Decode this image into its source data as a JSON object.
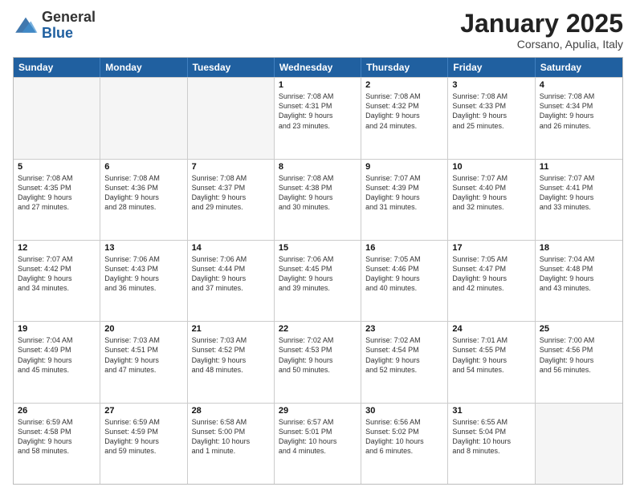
{
  "logo": {
    "general": "General",
    "blue": "Blue"
  },
  "header": {
    "title": "January 2025",
    "subtitle": "Corsano, Apulia, Italy"
  },
  "weekdays": [
    "Sunday",
    "Monday",
    "Tuesday",
    "Wednesday",
    "Thursday",
    "Friday",
    "Saturday"
  ],
  "weeks": [
    [
      {
        "day": "",
        "info": ""
      },
      {
        "day": "",
        "info": ""
      },
      {
        "day": "",
        "info": ""
      },
      {
        "day": "1",
        "info": "Sunrise: 7:08 AM\nSunset: 4:31 PM\nDaylight: 9 hours\nand 23 minutes."
      },
      {
        "day": "2",
        "info": "Sunrise: 7:08 AM\nSunset: 4:32 PM\nDaylight: 9 hours\nand 24 minutes."
      },
      {
        "day": "3",
        "info": "Sunrise: 7:08 AM\nSunset: 4:33 PM\nDaylight: 9 hours\nand 25 minutes."
      },
      {
        "day": "4",
        "info": "Sunrise: 7:08 AM\nSunset: 4:34 PM\nDaylight: 9 hours\nand 26 minutes."
      }
    ],
    [
      {
        "day": "5",
        "info": "Sunrise: 7:08 AM\nSunset: 4:35 PM\nDaylight: 9 hours\nand 27 minutes."
      },
      {
        "day": "6",
        "info": "Sunrise: 7:08 AM\nSunset: 4:36 PM\nDaylight: 9 hours\nand 28 minutes."
      },
      {
        "day": "7",
        "info": "Sunrise: 7:08 AM\nSunset: 4:37 PM\nDaylight: 9 hours\nand 29 minutes."
      },
      {
        "day": "8",
        "info": "Sunrise: 7:08 AM\nSunset: 4:38 PM\nDaylight: 9 hours\nand 30 minutes."
      },
      {
        "day": "9",
        "info": "Sunrise: 7:07 AM\nSunset: 4:39 PM\nDaylight: 9 hours\nand 31 minutes."
      },
      {
        "day": "10",
        "info": "Sunrise: 7:07 AM\nSunset: 4:40 PM\nDaylight: 9 hours\nand 32 minutes."
      },
      {
        "day": "11",
        "info": "Sunrise: 7:07 AM\nSunset: 4:41 PM\nDaylight: 9 hours\nand 33 minutes."
      }
    ],
    [
      {
        "day": "12",
        "info": "Sunrise: 7:07 AM\nSunset: 4:42 PM\nDaylight: 9 hours\nand 34 minutes."
      },
      {
        "day": "13",
        "info": "Sunrise: 7:06 AM\nSunset: 4:43 PM\nDaylight: 9 hours\nand 36 minutes."
      },
      {
        "day": "14",
        "info": "Sunrise: 7:06 AM\nSunset: 4:44 PM\nDaylight: 9 hours\nand 37 minutes."
      },
      {
        "day": "15",
        "info": "Sunrise: 7:06 AM\nSunset: 4:45 PM\nDaylight: 9 hours\nand 39 minutes."
      },
      {
        "day": "16",
        "info": "Sunrise: 7:05 AM\nSunset: 4:46 PM\nDaylight: 9 hours\nand 40 minutes."
      },
      {
        "day": "17",
        "info": "Sunrise: 7:05 AM\nSunset: 4:47 PM\nDaylight: 9 hours\nand 42 minutes."
      },
      {
        "day": "18",
        "info": "Sunrise: 7:04 AM\nSunset: 4:48 PM\nDaylight: 9 hours\nand 43 minutes."
      }
    ],
    [
      {
        "day": "19",
        "info": "Sunrise: 7:04 AM\nSunset: 4:49 PM\nDaylight: 9 hours\nand 45 minutes."
      },
      {
        "day": "20",
        "info": "Sunrise: 7:03 AM\nSunset: 4:51 PM\nDaylight: 9 hours\nand 47 minutes."
      },
      {
        "day": "21",
        "info": "Sunrise: 7:03 AM\nSunset: 4:52 PM\nDaylight: 9 hours\nand 48 minutes."
      },
      {
        "day": "22",
        "info": "Sunrise: 7:02 AM\nSunset: 4:53 PM\nDaylight: 9 hours\nand 50 minutes."
      },
      {
        "day": "23",
        "info": "Sunrise: 7:02 AM\nSunset: 4:54 PM\nDaylight: 9 hours\nand 52 minutes."
      },
      {
        "day": "24",
        "info": "Sunrise: 7:01 AM\nSunset: 4:55 PM\nDaylight: 9 hours\nand 54 minutes."
      },
      {
        "day": "25",
        "info": "Sunrise: 7:00 AM\nSunset: 4:56 PM\nDaylight: 9 hours\nand 56 minutes."
      }
    ],
    [
      {
        "day": "26",
        "info": "Sunrise: 6:59 AM\nSunset: 4:58 PM\nDaylight: 9 hours\nand 58 minutes."
      },
      {
        "day": "27",
        "info": "Sunrise: 6:59 AM\nSunset: 4:59 PM\nDaylight: 9 hours\nand 59 minutes."
      },
      {
        "day": "28",
        "info": "Sunrise: 6:58 AM\nSunset: 5:00 PM\nDaylight: 10 hours\nand 1 minute."
      },
      {
        "day": "29",
        "info": "Sunrise: 6:57 AM\nSunset: 5:01 PM\nDaylight: 10 hours\nand 4 minutes."
      },
      {
        "day": "30",
        "info": "Sunrise: 6:56 AM\nSunset: 5:02 PM\nDaylight: 10 hours\nand 6 minutes."
      },
      {
        "day": "31",
        "info": "Sunrise: 6:55 AM\nSunset: 5:04 PM\nDaylight: 10 hours\nand 8 minutes."
      },
      {
        "day": "",
        "info": ""
      }
    ]
  ]
}
